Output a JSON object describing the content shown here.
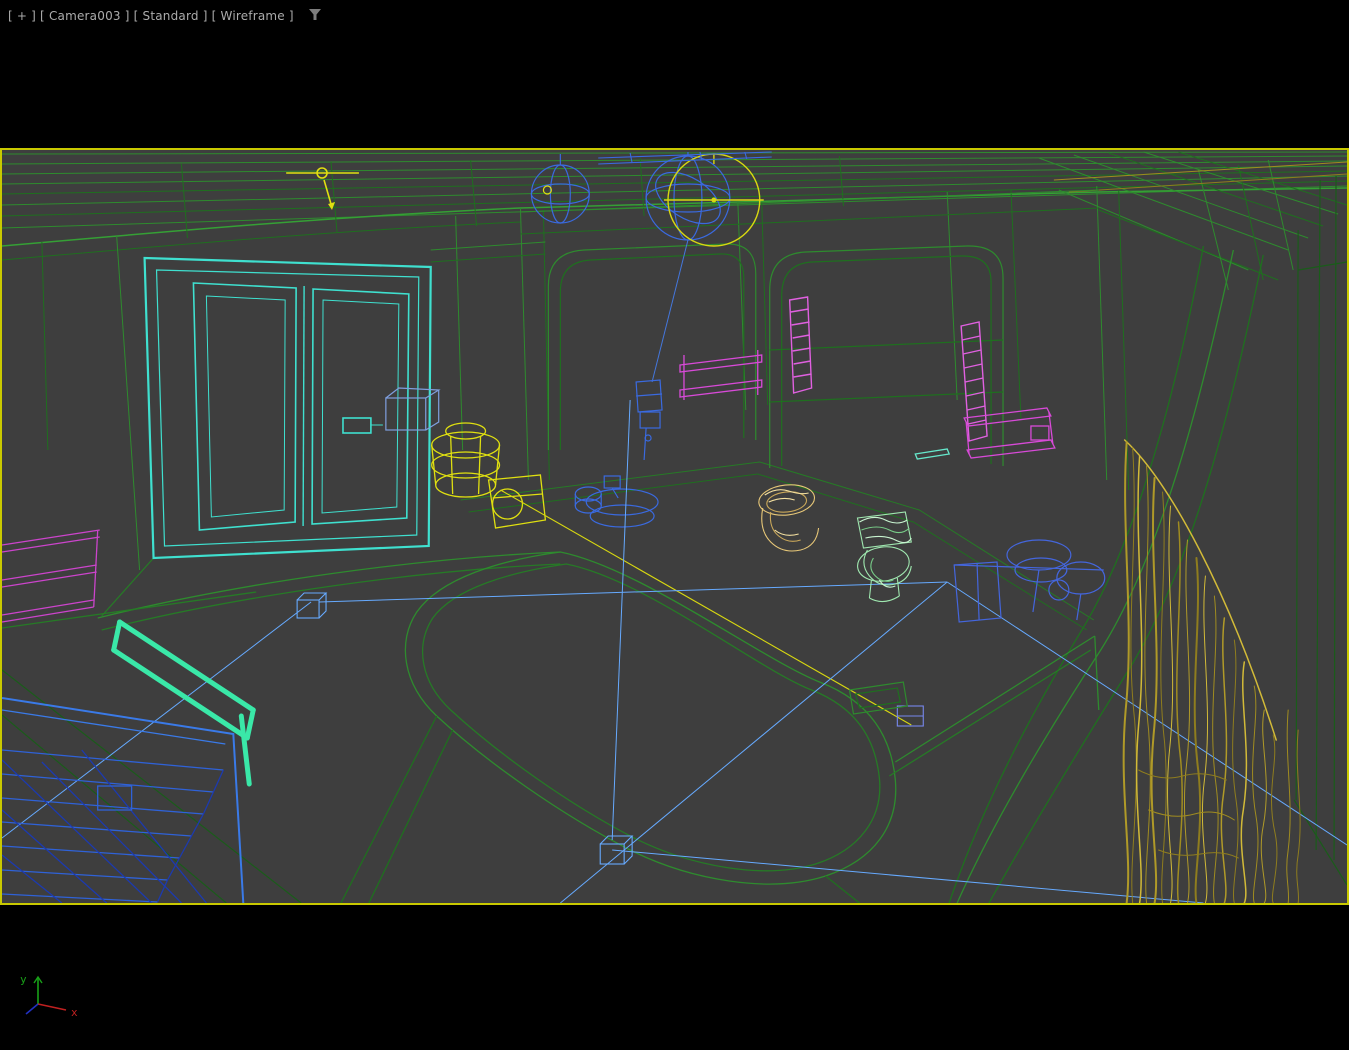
{
  "viewport_label": {
    "general_menu": "[ + ]",
    "pov_menu": "[ Camera003 ]",
    "style_menu": "[ Standard ]",
    "shading_menu": "[ Wireframe ]"
  },
  "axis_gizmo": {
    "x": "x",
    "y": "y"
  },
  "palette": {
    "page_background": "#000000",
    "viewport_background": "#3e3e3e",
    "viewport_border": "#c9c900",
    "label_text": "#ababab",
    "wire_green": "#2e8b2e",
    "wire_dark_green": "#1a5c1a",
    "door_cyan": "#3fe0cf",
    "helper_yellow": "#e0e010",
    "object_blue": "#3a6ae0",
    "construction_blue": "#66aaff",
    "accent_magenta": "#d84ad8",
    "curtain_khaki": "#b09a28",
    "toilet_pale_green": "#a0e8b0",
    "bidet_tan": "#e8c878",
    "towel_teal": "#3ae8a8",
    "stairs_blue": "#2f62d8",
    "axis_x_color": "#c02020",
    "axis_y_color": "#18a018"
  }
}
